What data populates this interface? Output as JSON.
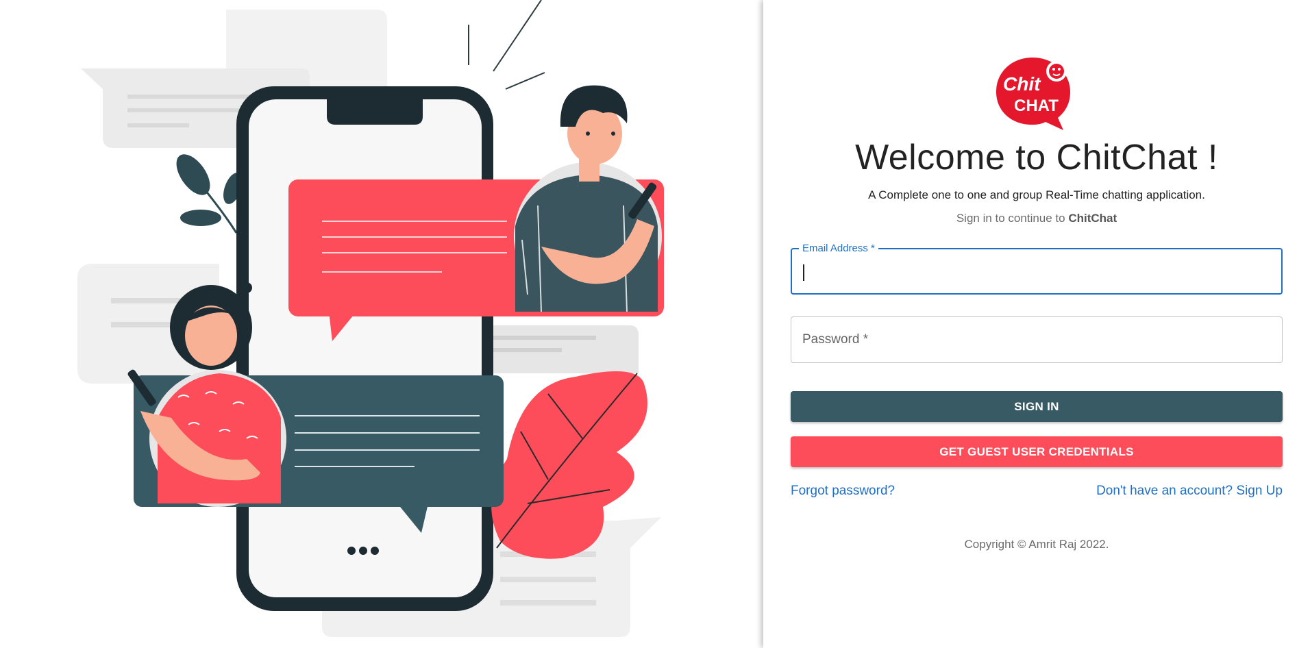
{
  "colors": {
    "primary": "#385a64",
    "accent": "#fe4d5a",
    "link": "#1f6fc4"
  },
  "logo": {
    "line1": "Chit",
    "line2": "CHAT"
  },
  "welcome": {
    "title": "Welcome to ChitChat !",
    "tagline": "A Complete one to one and group Real-Time chatting application.",
    "signin_prefix": "Sign in to continue to ",
    "signin_brand": "ChitChat"
  },
  "form": {
    "email": {
      "label": "Email Address *",
      "value": ""
    },
    "password": {
      "label": "Password *",
      "value": ""
    },
    "signin_label": "SIGN IN",
    "guest_label": "GET GUEST USER CREDENTIALS"
  },
  "links": {
    "forgot": "Forgot password?",
    "signup": "Don't have an account? Sign Up"
  },
  "footer": {
    "copyright": "Copyright © Amrit Raj 2022."
  },
  "illustration": {
    "dots": "●●●"
  }
}
